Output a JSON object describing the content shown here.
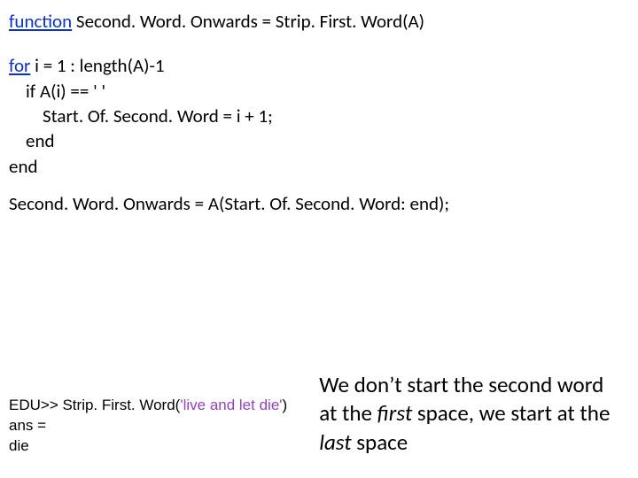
{
  "code": {
    "fn_kw": "function",
    "fn_sig": " Second. Word. Onwards = Strip. First. Word(A)",
    "for_kw": "for",
    "for_rest": " i = 1 : length(A)-1",
    "if_line": "    if A(i) == ' '",
    "assign_line": "        Start. Of. Second. Word = i + 1;",
    "end1": "    end",
    "end2": "end",
    "result_line": "Second. Word. Onwards = A(Start. Of. Second. Word: end);"
  },
  "repl": {
    "prompt_prefix": "EDU>> Strip. First. Word(",
    "arg": "'live and let die'",
    "prompt_suffix": ")",
    "ans_label": "ans =",
    "ans_value": "die"
  },
  "comment": {
    "t1": "We don’t start the second word at the ",
    "em1": "first",
    "t2": " space, we start at the ",
    "em2": "last",
    "t3": " space"
  }
}
